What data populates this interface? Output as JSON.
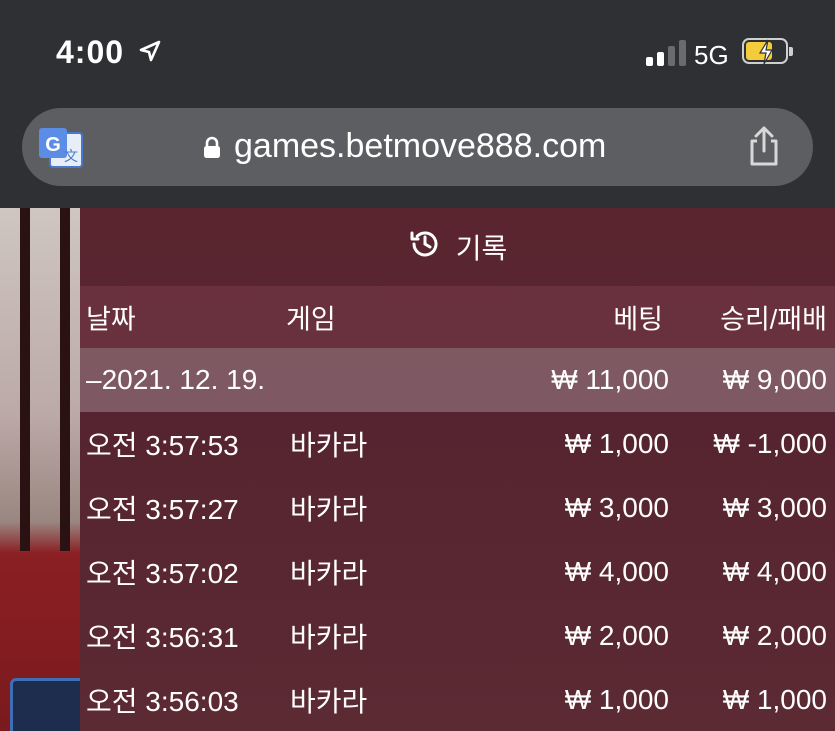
{
  "status_bar": {
    "time": "4:00",
    "network": "5G"
  },
  "browser": {
    "url": "games.betmove888.com"
  },
  "panel": {
    "title": "기록",
    "columns": {
      "date": "날짜",
      "game": "게임",
      "bet": "베팅",
      "result": "승리/패배"
    },
    "summary": {
      "date": "–2021. 12. 19.",
      "bet": "₩ 11,000",
      "result": "₩ 9,000"
    },
    "rows": [
      {
        "time": "오전 3:57:53",
        "game": "바카라",
        "bet": "₩ 1,000",
        "result": "₩ -1,000"
      },
      {
        "time": "오전 3:57:27",
        "game": "바카라",
        "bet": "₩ 3,000",
        "result": "₩ 3,000"
      },
      {
        "time": "오전 3:57:02",
        "game": "바카라",
        "bet": "₩ 4,000",
        "result": "₩ 4,000"
      },
      {
        "time": "오전 3:56:31",
        "game": "바카라",
        "bet": "₩ 2,000",
        "result": "₩ 2,000"
      },
      {
        "time": "오전 3:56:03",
        "game": "바카라",
        "bet": "₩ 1,000",
        "result": "₩ 1,000"
      }
    ]
  }
}
